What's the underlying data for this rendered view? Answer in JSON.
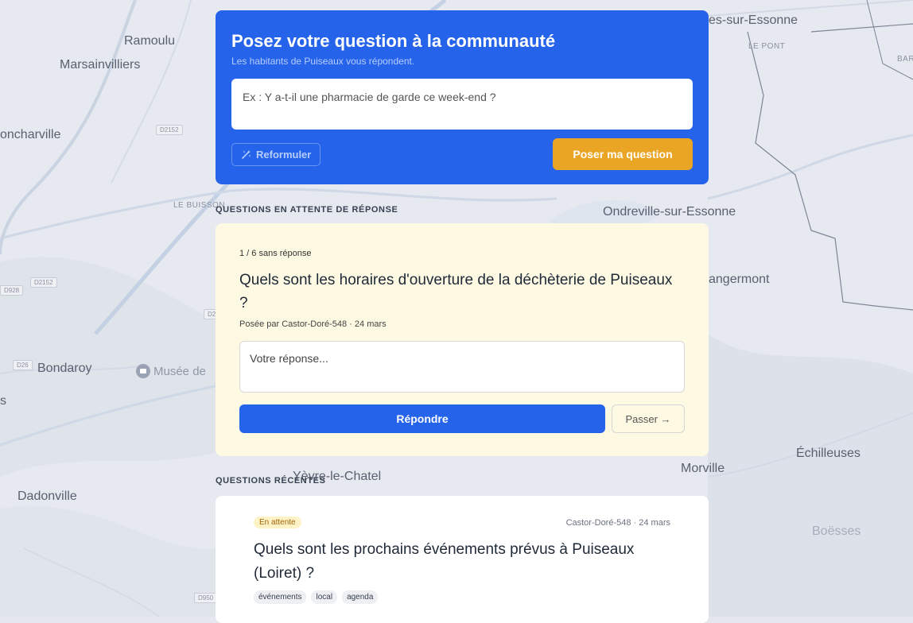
{
  "map": {
    "places": {
      "ramoulu": "Ramoulu",
      "marsainvilliers": "Marsainvilliers",
      "oncharville": "oncharville",
      "bondaroy": "Bondaroy",
      "musee": "Musée de",
      "dadonville": "Dadonville",
      "yevre": "Yèvre-le-Chatel",
      "morville": "Morville",
      "echilleuses": "Échilleuses",
      "boesses": "Boësses",
      "ondreville": "Ondreville-sur-Essonne",
      "angermont": "angermont",
      "sur_essonne": "es-sur-Essonne",
      "le_pont": "LE PONT",
      "bar": "BAR",
      "le_buisson": "LE BUISSON",
      "s": "s"
    },
    "roads": {
      "d2152a": "D2152",
      "d2152b": "D2152",
      "d928": "D928",
      "d26": "D26",
      "d2x": "D2",
      "d950": "D950"
    }
  },
  "ask": {
    "title": "Posez votre question à la communauté",
    "subtitle": "Les habitants de Puiseaux vous répondent.",
    "placeholder": "Ex : Y a-t-il une pharmacie de garde ce week-end ?",
    "reformulate_label": "Reformuler",
    "submit_label": "Poser ma question"
  },
  "pending": {
    "section_title": "QUESTIONS EN ATTENTE DE RÉPONSE",
    "count": "1 / 6 sans réponse",
    "question": "Quels sont les horaires d'ouverture de la déchèterie de Puiseaux ?",
    "meta": "Posée par Castor-Doré-548 · 24 mars",
    "answer_placeholder": "Votre réponse...",
    "reply_label": "Répondre",
    "skip_label": "Passer →"
  },
  "recent": {
    "section_title": "QUESTIONS RÉCENTES",
    "items": [
      {
        "status": "En attente",
        "meta": "Castor-Doré-548 · 24 mars",
        "question": "Quels sont les prochains événements prévus à Puiseaux (Loiret) ?",
        "tags": [
          "événements",
          "local",
          "agenda"
        ]
      }
    ]
  },
  "colors": {
    "primary": "#2563eb",
    "accent": "#eaa524",
    "pending_bg": "#fdf9e3"
  }
}
